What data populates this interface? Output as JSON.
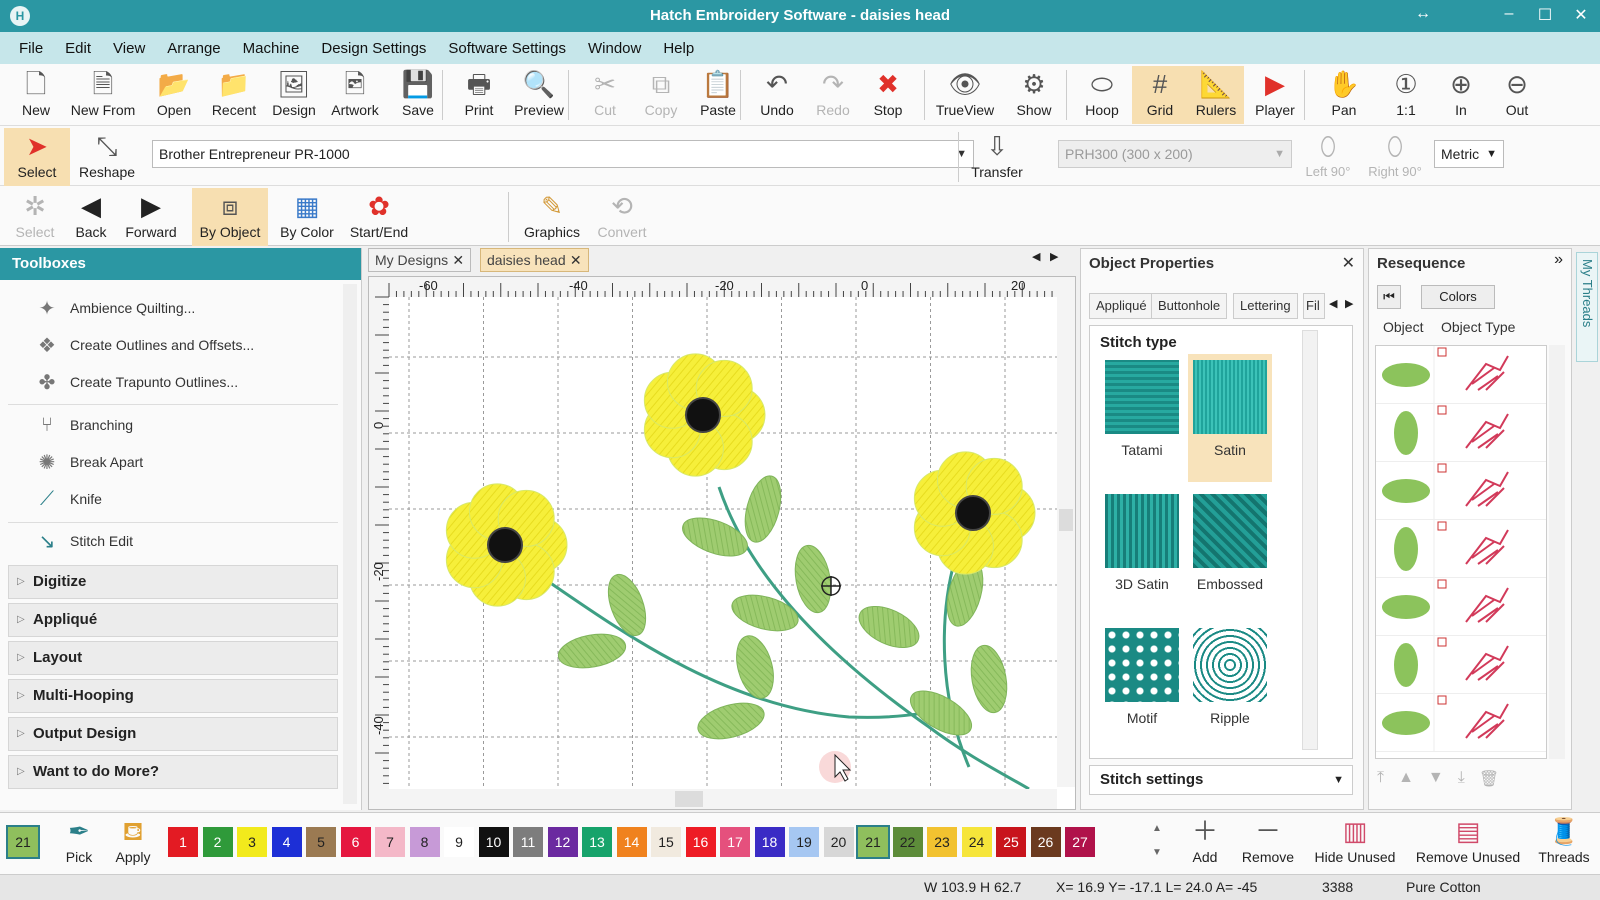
{
  "window": {
    "title": "Hatch Embroidery Software - daisies head"
  },
  "menu": [
    "File",
    "Edit",
    "View",
    "Arrange",
    "Machine",
    "Design Settings",
    "Software Settings",
    "Window",
    "Help"
  ],
  "toolbar1": [
    {
      "label": "New",
      "icon": "new-doc-icon",
      "glyph": "🗋"
    },
    {
      "label": "New From",
      "icon": "new-from-icon",
      "glyph": "🗎"
    },
    {
      "label": "Open",
      "icon": "folder-open-icon",
      "glyph": "📂"
    },
    {
      "label": "Recent",
      "icon": "recent-folder-icon",
      "glyph": "📁"
    },
    {
      "label": "Design",
      "icon": "design-icon",
      "glyph": "🖼"
    },
    {
      "label": "Artwork",
      "icon": "artwork-icon",
      "glyph": "🖻"
    },
    {
      "label": "Save",
      "icon": "save-icon",
      "glyph": "💾"
    },
    {
      "label": "Print",
      "icon": "print-icon",
      "glyph": "🖶"
    },
    {
      "label": "Preview",
      "icon": "preview-icon",
      "glyph": "🔍"
    },
    {
      "label": "Cut",
      "icon": "scissors-icon",
      "glyph": "✂"
    },
    {
      "label": "Copy",
      "icon": "copy-icon",
      "glyph": "⧉"
    },
    {
      "label": "Paste",
      "icon": "paste-icon",
      "glyph": "📋"
    },
    {
      "label": "Undo",
      "icon": "undo-icon",
      "glyph": "↶"
    },
    {
      "label": "Redo",
      "icon": "redo-icon",
      "glyph": "↷"
    },
    {
      "label": "Stop",
      "icon": "stop-icon",
      "glyph": "✖"
    },
    {
      "label": "TrueView",
      "icon": "trueview-eye-icon",
      "glyph": "👁"
    },
    {
      "label": "Show",
      "icon": "show-icon",
      "glyph": "⚙"
    },
    {
      "label": "Hoop",
      "icon": "hoop-icon",
      "glyph": "⬭"
    },
    {
      "label": "Grid",
      "icon": "grid-icon",
      "glyph": "#"
    },
    {
      "label": "Rulers",
      "icon": "rulers-icon",
      "glyph": "📐"
    },
    {
      "label": "Player",
      "icon": "play-icon",
      "glyph": "▶"
    },
    {
      "label": "Pan",
      "icon": "hand-icon",
      "glyph": "✋"
    },
    {
      "label": "1:1",
      "icon": "zoom-1-1-icon",
      "glyph": "①"
    },
    {
      "label": "In",
      "icon": "zoom-in-icon",
      "glyph": "⊕"
    },
    {
      "label": "Out",
      "icon": "zoom-out-icon",
      "glyph": "⊖"
    }
  ],
  "toolbar2": {
    "select_label": "Select",
    "reshape_label": "Reshape",
    "machine": "Brother Entrepreneur PR-1000",
    "transfer_label": "Transfer",
    "hoop": "PRH300 (300 x 200)",
    "left90": "Left 90°",
    "right90": "Right 90°",
    "units": "Metric"
  },
  "toolbar3": {
    "select": "Select",
    "back": "Back",
    "forward": "Forward",
    "by_object": "By Object",
    "by_color": "By Color",
    "start_end": "Start/End",
    "graphics": "Graphics",
    "convert": "Convert"
  },
  "toolboxes": {
    "title": "Toolboxes",
    "items": [
      "Ambience Quilting...",
      "Create Outlines and Offsets...",
      "Create Trapunto Outlines...",
      "Branching",
      "Break Apart",
      "Knife",
      "Stitch Edit"
    ],
    "sections": [
      "Digitize",
      "Appliqué",
      "Layout",
      "Multi-Hooping",
      "Output Design",
      "Want to do More?"
    ]
  },
  "doc_tabs": [
    "My Designs",
    "daisies head"
  ],
  "ruler": {
    "h_labels": [
      "-60",
      "-40",
      "-20",
      "0",
      "20"
    ],
    "v_labels": [
      "0",
      "-20",
      "-40"
    ]
  },
  "object_properties": {
    "title": "Object Properties",
    "tabs": [
      "Appliqué",
      "Buttonhole",
      "Lettering",
      "Fil"
    ],
    "stitch_type_label": "Stitch type",
    "stitch_types": [
      "Tatami",
      "Satin",
      "3D Satin",
      "Embossed",
      "Motif",
      "Ripple"
    ],
    "selected_stitch_type": "Satin",
    "stitch_settings_label": "Stitch settings"
  },
  "resequence": {
    "title": "Resequence",
    "colors_btn": "Colors",
    "col_object": "Object",
    "col_object_type": "Object Type"
  },
  "my_threads": "My Threads",
  "thread_chips": [
    {
      "n": "1",
      "c": "#e31b23"
    },
    {
      "n": "2",
      "c": "#2f9a3a"
    },
    {
      "n": "3",
      "c": "#f2ea1c"
    },
    {
      "n": "4",
      "c": "#1d2fd6"
    },
    {
      "n": "5",
      "c": "#9b7a52"
    },
    {
      "n": "6",
      "c": "#e5173f"
    },
    {
      "n": "7",
      "c": "#f4b8c8"
    },
    {
      "n": "8",
      "c": "#c79ad7"
    },
    {
      "n": "9",
      "c": "#ffffff"
    },
    {
      "n": "10",
      "c": "#111111"
    },
    {
      "n": "11",
      "c": "#7d7d7d"
    },
    {
      "n": "12",
      "c": "#6b2aa0"
    },
    {
      "n": "13",
      "c": "#17a36b"
    },
    {
      "n": "14",
      "c": "#f0821e"
    },
    {
      "n": "15",
      "c": "#f1eadf"
    },
    {
      "n": "16",
      "c": "#ee1c25"
    },
    {
      "n": "17",
      "c": "#e5507d"
    },
    {
      "n": "18",
      "c": "#3a2bc5"
    },
    {
      "n": "19",
      "c": "#a6c7f2"
    },
    {
      "n": "20",
      "c": "#d7d7d7"
    },
    {
      "n": "21",
      "c": "#8fbf5d"
    },
    {
      "n": "22",
      "c": "#5d8c3a"
    },
    {
      "n": "23",
      "c": "#f2c230"
    },
    {
      "n": "24",
      "c": "#f6e53a"
    },
    {
      "n": "25",
      "c": "#c8141c"
    },
    {
      "n": "26",
      "c": "#6b3a1f"
    },
    {
      "n": "27",
      "c": "#b0124a"
    }
  ],
  "colorbar": {
    "current": "21",
    "pick": "Pick",
    "apply": "Apply",
    "add": "Add",
    "remove": "Remove",
    "hide_unused": "Hide Unused",
    "remove_unused": "Remove Unused",
    "threads": "Threads"
  },
  "status": {
    "size": "W 103.9 H  62.7",
    "coords": "X=  16.9 Y=  -17.1 L= 24.0 A= -45",
    "stitches": "3388",
    "thread": "Pure Cotton"
  }
}
